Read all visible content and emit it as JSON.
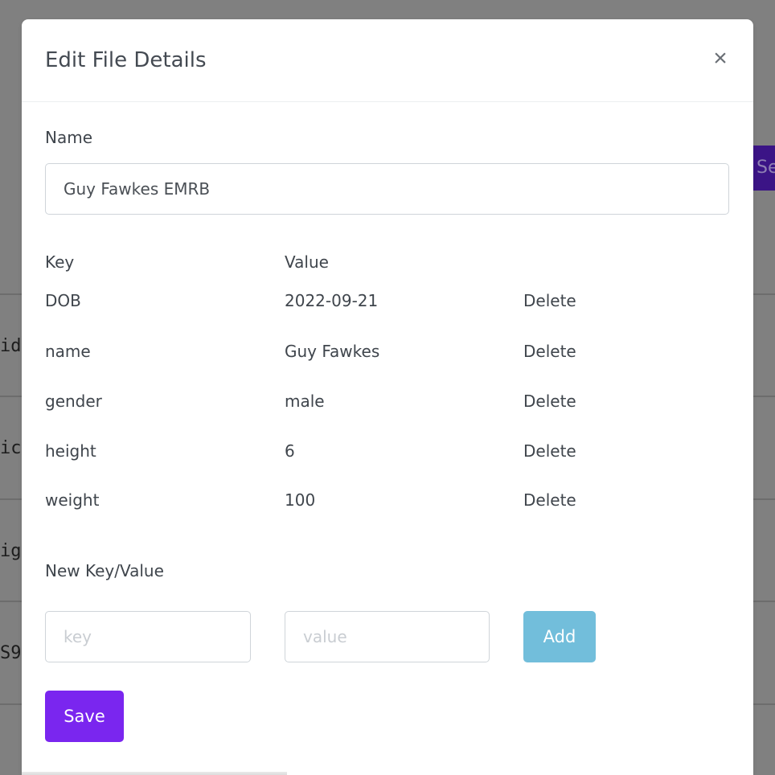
{
  "background": {
    "row_fragments": [
      "id",
      "ic",
      "ig",
      "S9"
    ],
    "side_button_label": "Se"
  },
  "modal": {
    "title": "Edit File Details",
    "close_symbol": "×",
    "name_label": "Name",
    "name_value": "Guy Fawkes EMRB",
    "key_header": "Key",
    "value_header": "Value",
    "rows": [
      {
        "key": "DOB",
        "value": "2022-09-21",
        "action": "Delete"
      },
      {
        "key": "name",
        "value": "Guy Fawkes",
        "action": "Delete"
      },
      {
        "key": "gender",
        "value": "male",
        "action": "Delete"
      },
      {
        "key": "height",
        "value": "6",
        "action": "Delete"
      },
      {
        "key": "weight",
        "value": "100",
        "action": "Delete"
      }
    ],
    "new_kv_label": "New Key/Value",
    "key_placeholder": "key",
    "value_placeholder": "value",
    "add_label": "Add",
    "save_label": "Save"
  },
  "colors": {
    "backdrop": "#808080",
    "accent": "#7a26ef",
    "add_button": "#72bedb"
  }
}
